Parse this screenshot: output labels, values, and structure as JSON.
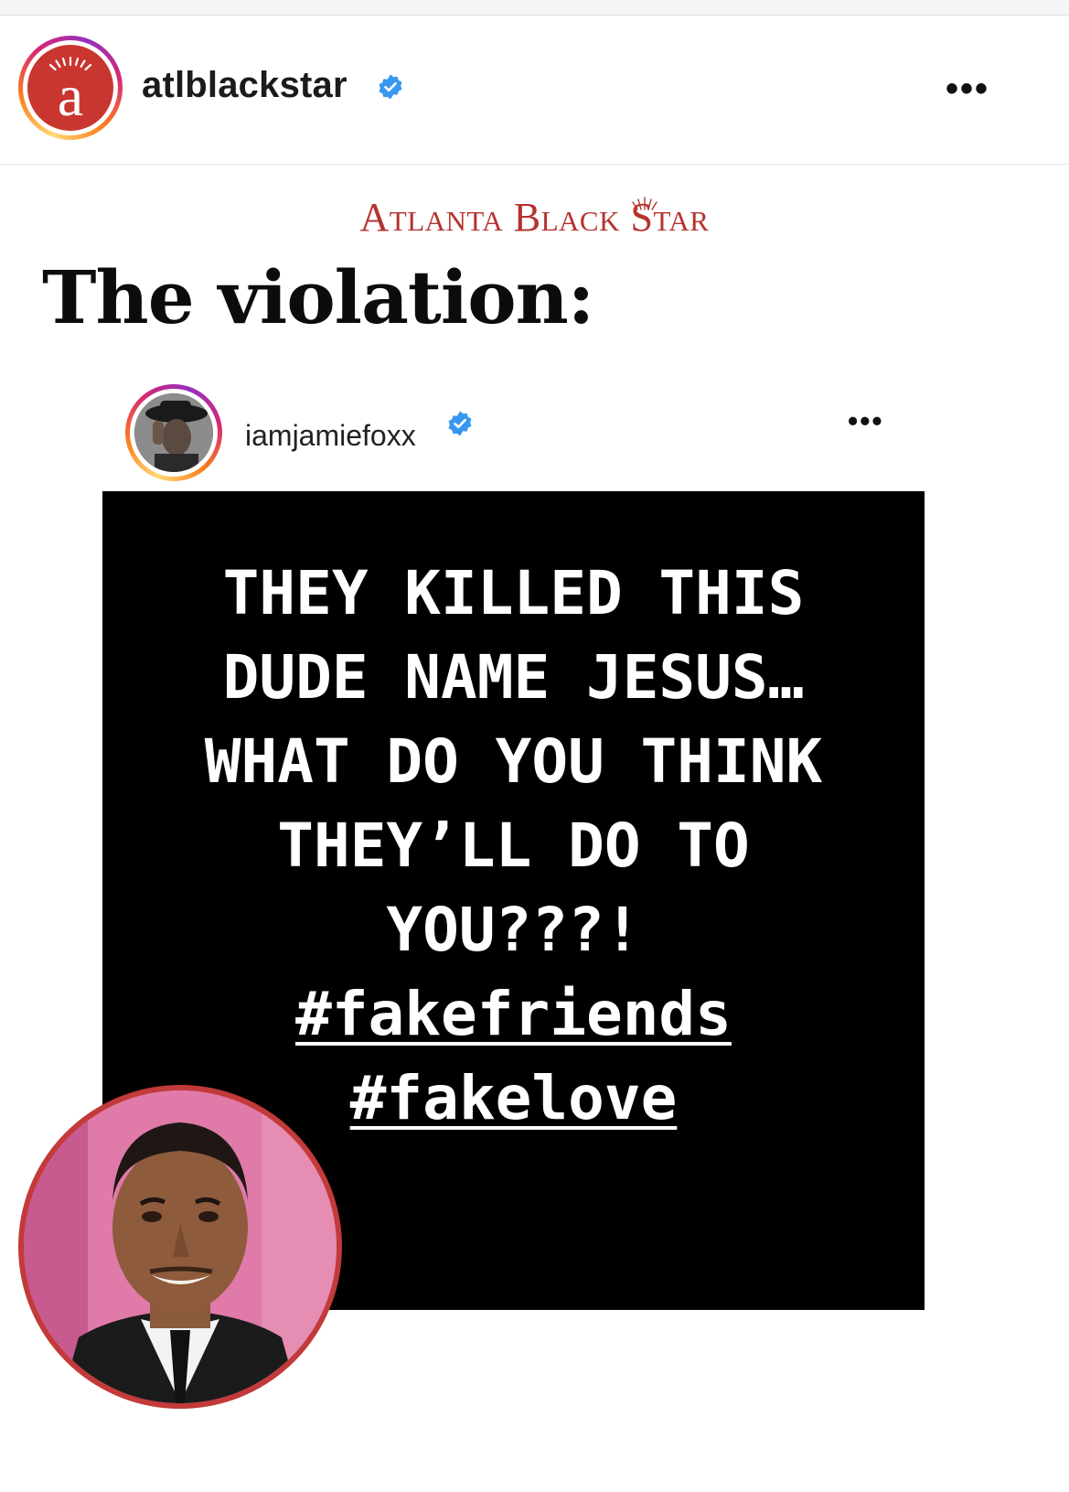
{
  "post": {
    "username": "atlblackstar",
    "avatar_letter": "a",
    "more": "•••",
    "colors": {
      "brand_red": "#c8362f",
      "verified_blue": "#3897f0"
    }
  },
  "card": {
    "brand": "Atlanta Black Star",
    "headline": "The violation:"
  },
  "embed": {
    "username": "iamjamiefoxx",
    "more": "•••",
    "story_lines": [
      "THEY KILLED THIS",
      "DUDE NAME JESUS…",
      "WHAT DO YOU THINK",
      "THEY’LL DO TO",
      "YOU???!"
    ],
    "hashtags": [
      "#fakefriends",
      "#fakelove"
    ]
  }
}
